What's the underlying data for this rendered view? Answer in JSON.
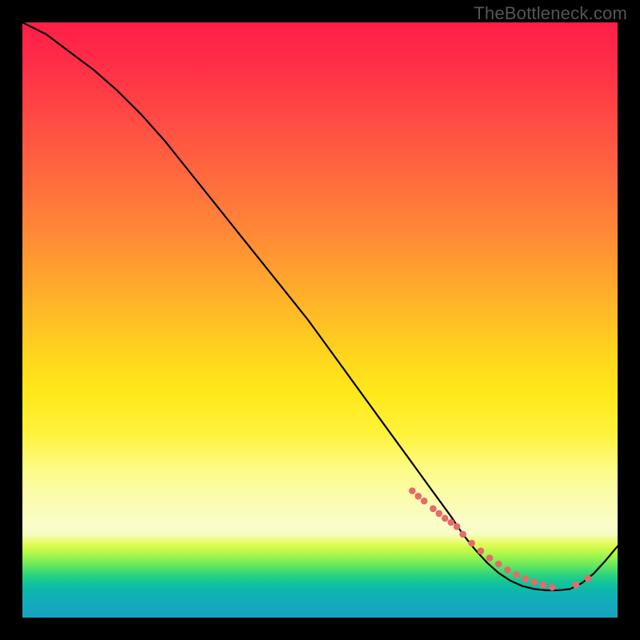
{
  "watermark": "TheBottleneck.com",
  "chart_data": {
    "type": "line",
    "title": "",
    "xlabel": "",
    "ylabel": "",
    "xlim": [
      0,
      100
    ],
    "ylim": [
      0,
      100
    ],
    "grid": false,
    "legend": false,
    "series": [
      {
        "name": "curve",
        "x": [
          0,
          4,
          8,
          12,
          16,
          20,
          24,
          28,
          32,
          36,
          40,
          44,
          48,
          52,
          56,
          60,
          64,
          68,
          72,
          74,
          76,
          78,
          80,
          82,
          84,
          86,
          88,
          90,
          92,
          94,
          96,
          98,
          100
        ],
        "y": [
          100,
          98,
          95,
          92,
          88.5,
          84.5,
          80,
          75,
          70,
          65,
          60,
          55,
          50,
          44.5,
          39,
          33.5,
          28,
          22.5,
          17,
          14,
          11.5,
          9.3,
          7.5,
          6.2,
          5.3,
          4.8,
          4.6,
          4.6,
          4.8,
          5.8,
          7.4,
          9.6,
          12
        ]
      }
    ],
    "markers": {
      "name": "highlight-dots",
      "color": "#e76a6a",
      "radius": 4.3,
      "x": [
        65.5,
        66.5,
        67.5,
        69,
        70,
        71,
        72,
        73,
        74,
        75.5,
        77,
        78.5,
        80,
        81.5,
        83,
        84.5,
        86,
        87.5,
        89,
        93,
        95
      ],
      "y": [
        21.3,
        20.4,
        19.6,
        18.3,
        17.5,
        16.7,
        16,
        15.3,
        14,
        12.5,
        11.2,
        10,
        9,
        8,
        7.2,
        6.5,
        6,
        5.5,
        5.1,
        5.5,
        6.6
      ]
    },
    "background_gradient": {
      "direction": "vertical",
      "stops": [
        {
          "pos": 0.0,
          "color": "#ff1f48"
        },
        {
          "pos": 0.36,
          "color": "#ff8b36"
        },
        {
          "pos": 0.62,
          "color": "#ffe81a"
        },
        {
          "pos": 0.84,
          "color": "#fafdc8"
        },
        {
          "pos": 0.9,
          "color": "#93f24f"
        },
        {
          "pos": 0.94,
          "color": "#15c596"
        },
        {
          "pos": 1.0,
          "color": "#15a4c0"
        }
      ]
    }
  }
}
